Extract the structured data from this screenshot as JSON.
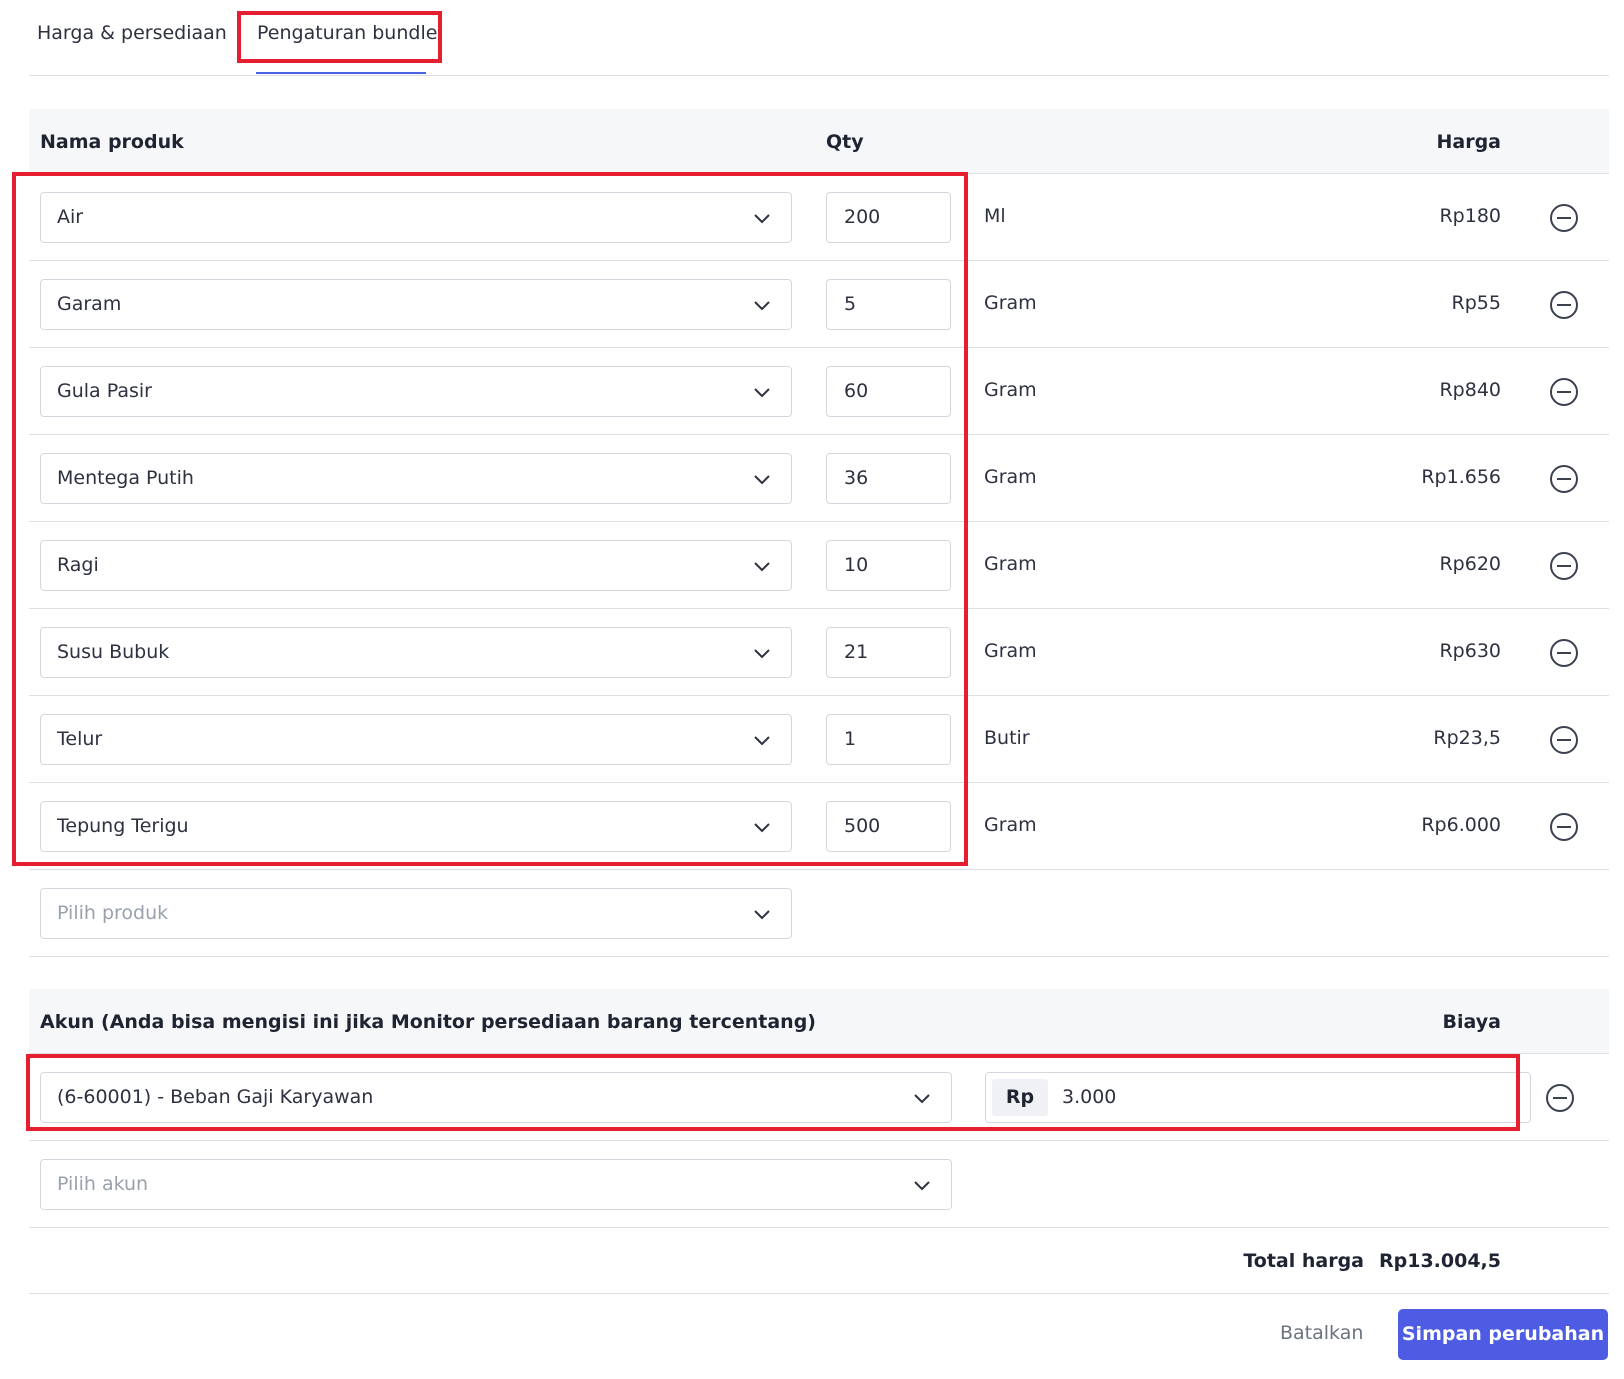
{
  "tabs": [
    {
      "label": "Harga & persediaan"
    },
    {
      "label": "Pengaturan bundle"
    }
  ],
  "products_table": {
    "headers": {
      "name": "Nama produk",
      "qty": "Qty",
      "price": "Harga"
    },
    "rows": [
      {
        "name": "Air",
        "qty": "200",
        "unit": "Ml",
        "price": "Rp180"
      },
      {
        "name": "Garam",
        "qty": "5",
        "unit": "Gram",
        "price": "Rp55"
      },
      {
        "name": "Gula Pasir",
        "qty": "60",
        "unit": "Gram",
        "price": "Rp840"
      },
      {
        "name": "Mentega Putih",
        "qty": "36",
        "unit": "Gram",
        "price": "Rp1.656"
      },
      {
        "name": "Ragi",
        "qty": "10",
        "unit": "Gram",
        "price": "Rp620"
      },
      {
        "name": "Susu Bubuk",
        "qty": "21",
        "unit": "Gram",
        "price": "Rp630"
      },
      {
        "name": "Telur",
        "qty": "1",
        "unit": "Butir",
        "price": "Rp23,5"
      },
      {
        "name": "Tepung Terigu",
        "qty": "500",
        "unit": "Gram",
        "price": "Rp6.000"
      }
    ],
    "add_placeholder": "Pilih produk"
  },
  "accounts_table": {
    "headers": {
      "account": "Akun (Anda bisa mengisi ini jika Monitor persediaan barang tercentang)",
      "cost": "Biaya"
    },
    "rows": [
      {
        "account": "(6-60001) - Beban Gaji Karyawan",
        "currency": "Rp",
        "cost": "3.000"
      }
    ],
    "add_placeholder": "Pilih akun"
  },
  "total": {
    "label": "Total harga",
    "value": "Rp13.004,5"
  },
  "actions": {
    "cancel": "Batalkan",
    "save": "Simpan perubahan"
  },
  "colors": {
    "accent": "#4e5ce4",
    "highlight": "#e51f2f",
    "header_bg": "#f6f7f9"
  }
}
